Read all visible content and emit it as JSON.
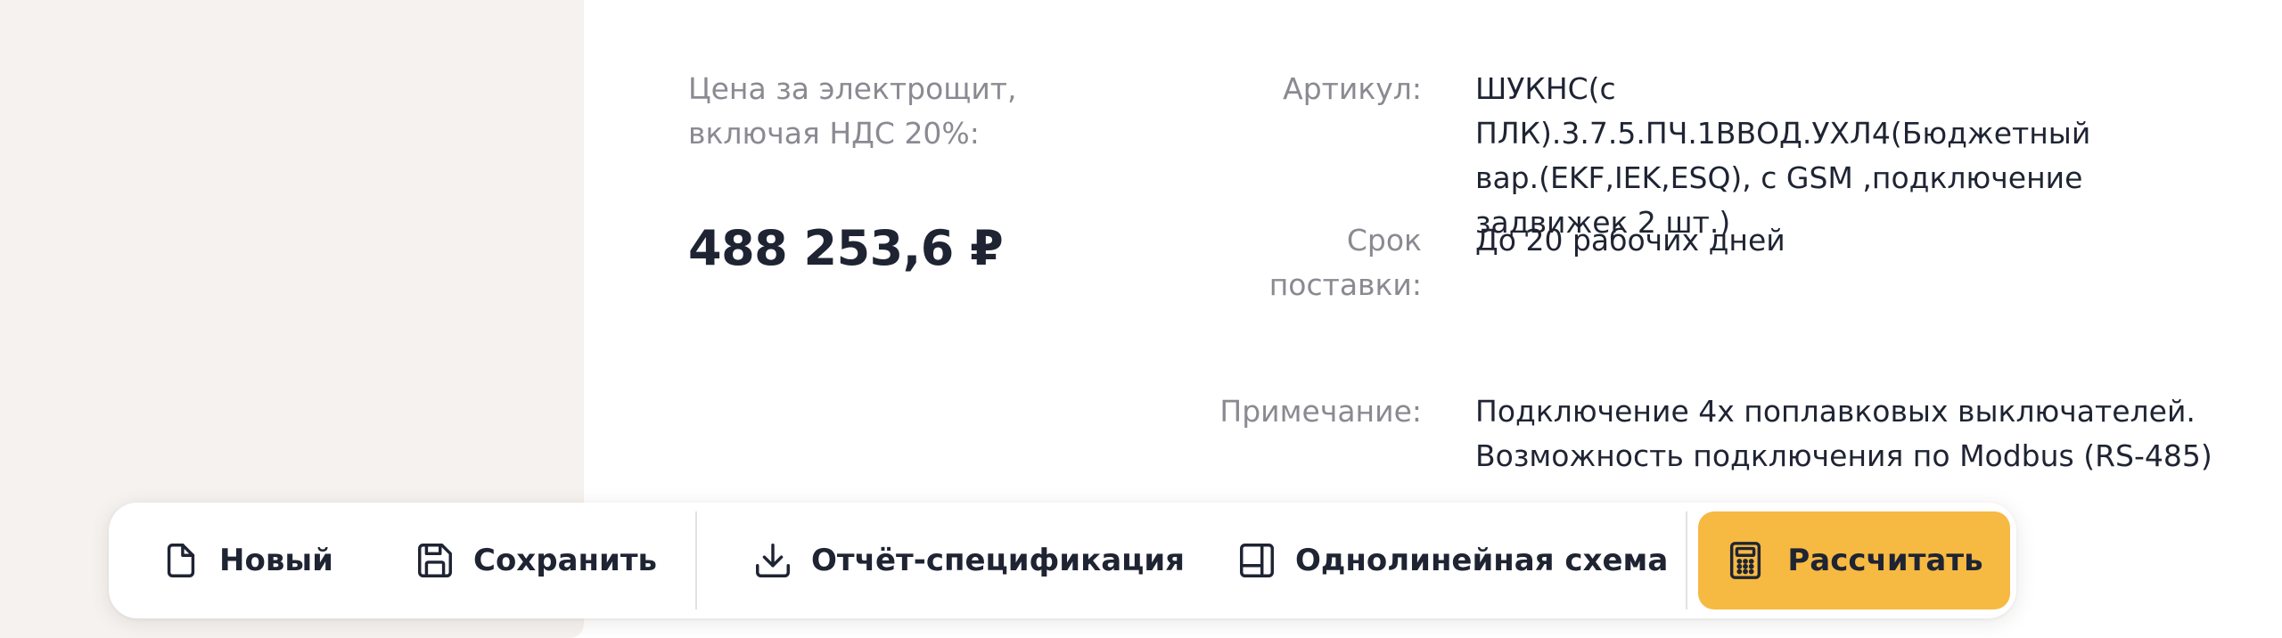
{
  "price": {
    "caption_line1": "Цена за электрощит,",
    "caption_line2": "включая НДС 20%:",
    "value": "488 253,6 ₽"
  },
  "details": {
    "article": {
      "label": "Артикул:",
      "value_line1": "ШУКНС(с ПЛК).3.7.5.ПЧ.1ВВОД.УХЛ4(Бюджетный",
      "value_line2": "вар.(EKF,IEK,ESQ), с GSM ,подключение",
      "value_line3": "задвижек 2 шт.)"
    },
    "delivery": {
      "label_line1": "Срок",
      "label_line2": "поставки:",
      "value": "До 20 рабочих дней"
    },
    "note": {
      "label": "Примечание:",
      "value_line1": "Подключение 4х поплавковых выключателей.",
      "value_line2": "Возможность подключения по Modbus (RS-485)"
    }
  },
  "toolbar": {
    "new_label": "Новый",
    "new_icon": "file-icon",
    "save_label": "Сохранить",
    "save_icon": "floppy-disk-icon",
    "report_label": "Отчёт-спецификация",
    "report_icon": "download-icon",
    "schema_label": "Однолинейная схема",
    "schema_icon": "layout-panel-icon",
    "calculate_label": "Рассчитать",
    "calculate_icon": "calculator-icon"
  },
  "colors": {
    "accent": "#f6b942",
    "text_primary": "#1f2433",
    "text_secondary": "#8a8a92",
    "side_panel": "#f6f2ef"
  }
}
